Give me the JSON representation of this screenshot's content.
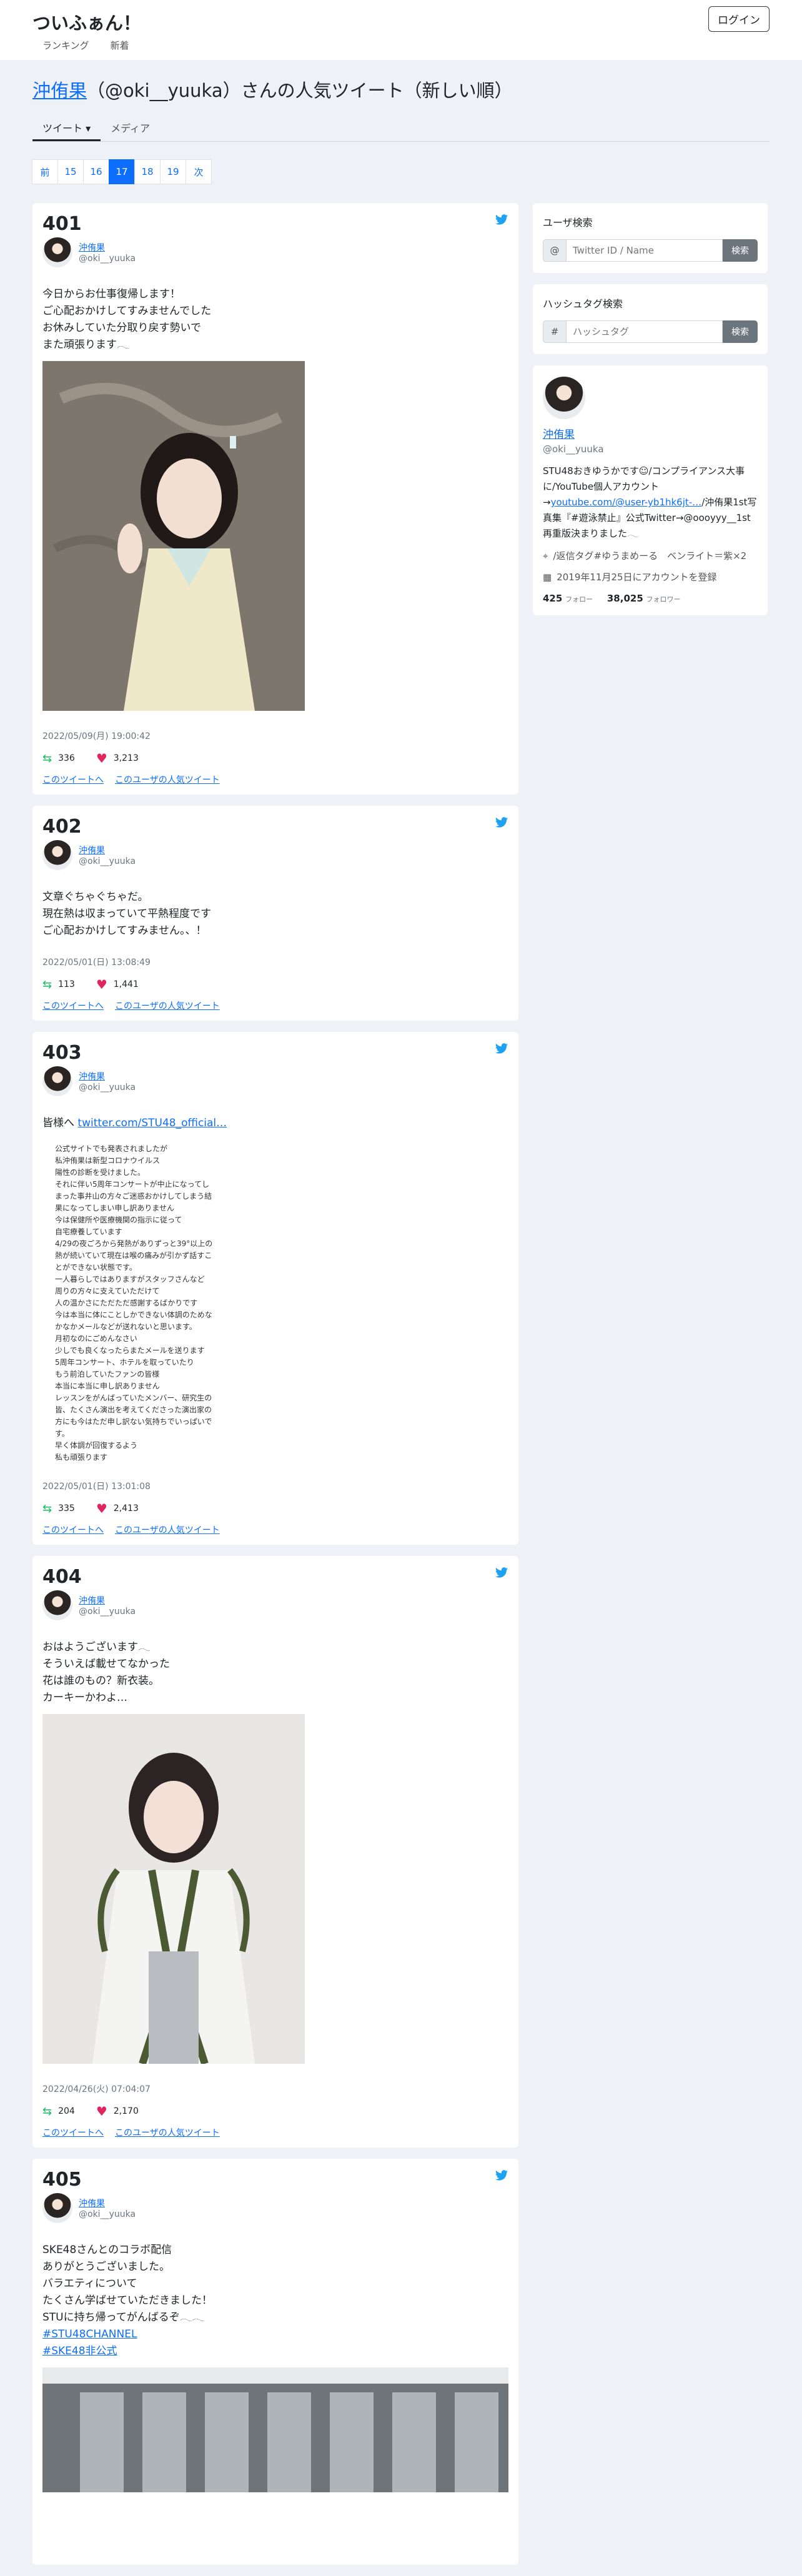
{
  "app": {
    "brand": "ついふぁん！",
    "login": "ログイン",
    "nav": [
      "ランキング",
      "新着"
    ]
  },
  "page": {
    "title_user": "沖侑果",
    "title_rest": "（@oki__yuuka）さんの人気ツイート（新しい順）"
  },
  "tabs": [
    "ツイート ▾",
    "メディア"
  ],
  "pager": [
    "前",
    "15",
    "16",
    "17",
    "18",
    "19",
    "次"
  ],
  "pager_active": "17",
  "user": {
    "name": "沖侑果",
    "id": "@oki__yuuka"
  },
  "links": {
    "tweet": "このツイートへ",
    "popular": "このユーザの人気ツイート"
  },
  "tweets": [
    {
      "num": "401",
      "lines": [
        "今日からお仕事復帰します！",
        "ご心配おかけしてすみませんでした",
        "お休みしていた分取り戻す勢いで",
        "また頑張ります𓂃"
      ],
      "date": "2022/05/09(月) 19:00:42",
      "rt": "336",
      "likes": "3,213"
    },
    {
      "num": "402",
      "lines": [
        "文章ぐちゃぐちゃだ。",
        "現在熱は収まっていて平熱程度です",
        "ご心配おかけしてすみません。、！"
      ],
      "date": "2022/05/01(日) 13:08:49",
      "rt": "113",
      "likes": "1,441"
    },
    {
      "num": "403",
      "lines": [
        "皆様へ"
      ],
      "link": "twitter.com/STU48_official…",
      "scan": [
        "公式サイトでも発表されましたが",
        "私沖侑果は新型コロナウイルス",
        "陽性の診断を受けました。",
        "それに伴い5周年コンサートが中止になってし",
        "まった事井山の方々ご迷惑おかけしてしまう結",
        "果になってしまい申し訳ありません",
        "今は保健所や医療機関の指示に従って",
        "自宅療養しています",
        "4/29の夜ごろから発熱がありずっと39°以上の",
        "熱が続いていて現在は喉の痛みが引かず話すこ",
        "とができない状態です。",
        "一人暮らしではありますがスタッフさんなど",
        "周りの方々に支えていただけて",
        "人の温かさにただただ感謝するばかりです",
        "今は本当に体にことしかできない体調のためな",
        "かなかメールなどが送れないと思います。",
        "月初なのにごめんなさい",
        "少しでも良くなったらまたメールを送ります",
        "5周年コンサート、ホテルを取っていたり",
        "もう前泊していたファンの皆様",
        "本当に本当に申し訳ありません",
        "レッスンをがんばっていたメンバー、研究生の",
        "皆、たくさん演出を考えてくださった演出家の",
        "方にも今はただ申し訳ない気持ちでいっぱいで",
        "す。",
        "早く体調が回復するよう",
        "私も頑張ります"
      ],
      "date": "2022/05/01(日) 13:01:08",
      "rt": "335",
      "likes": "2,413"
    },
    {
      "num": "404",
      "lines": [
        "おはようございます𓂃",
        "そういえば載せてなかった",
        "花は誰のもの？新衣装。",
        "カーキーかわよ…"
      ],
      "date": "2022/04/26(火) 07:04:07",
      "rt": "204",
      "likes": "2,170"
    },
    {
      "num": "405",
      "lines": [
        "SKE48さんとのコラボ配信",
        "ありがとうございました。",
        "バラエティについて",
        "たくさん学ばせていただきました！",
        "STUに持ち帰ってがんばるぞ𓂃𓂃"
      ],
      "tags": [
        "#STU48CHANNEL",
        "#SKE48非公式"
      ]
    }
  ],
  "side": {
    "user_search": {
      "title": "ユーザ検索",
      "prefix": "@",
      "placeholder": "Twitter ID / Name",
      "button": "検索"
    },
    "tag_search": {
      "title": "ハッシュタグ検索",
      "prefix": "#",
      "placeholder": "ハッシュタグ",
      "button": "検索"
    },
    "profile": {
      "name": "沖侑果",
      "id": "@oki__yuuka",
      "bio_1": "STU48おきゆうかです☺︎/コンプライアンス大事に/YouTube個人アカウント→",
      "bio_link": "youtube.com/@user-yb1hk6jt-…",
      "bio_2": "/沖侑果1st写真集『#遊泳禁止』公式Twitter→@oooyyy__1st 再重版決まりました𓂃",
      "location": "/返信タグ#ゆうまめーる　ベンライト＝紫×2",
      "joined": "2019年11月25日にアカウントを登録",
      "follow": "425",
      "follow_label": "フォロー",
      "follower": "38,025",
      "follower_label": "フォロワー"
    }
  },
  "colors": {
    "accent": "#0d6efd",
    "retweet": "#17bf63",
    "like": "#e0245e",
    "twitter": "#1da1f2"
  }
}
